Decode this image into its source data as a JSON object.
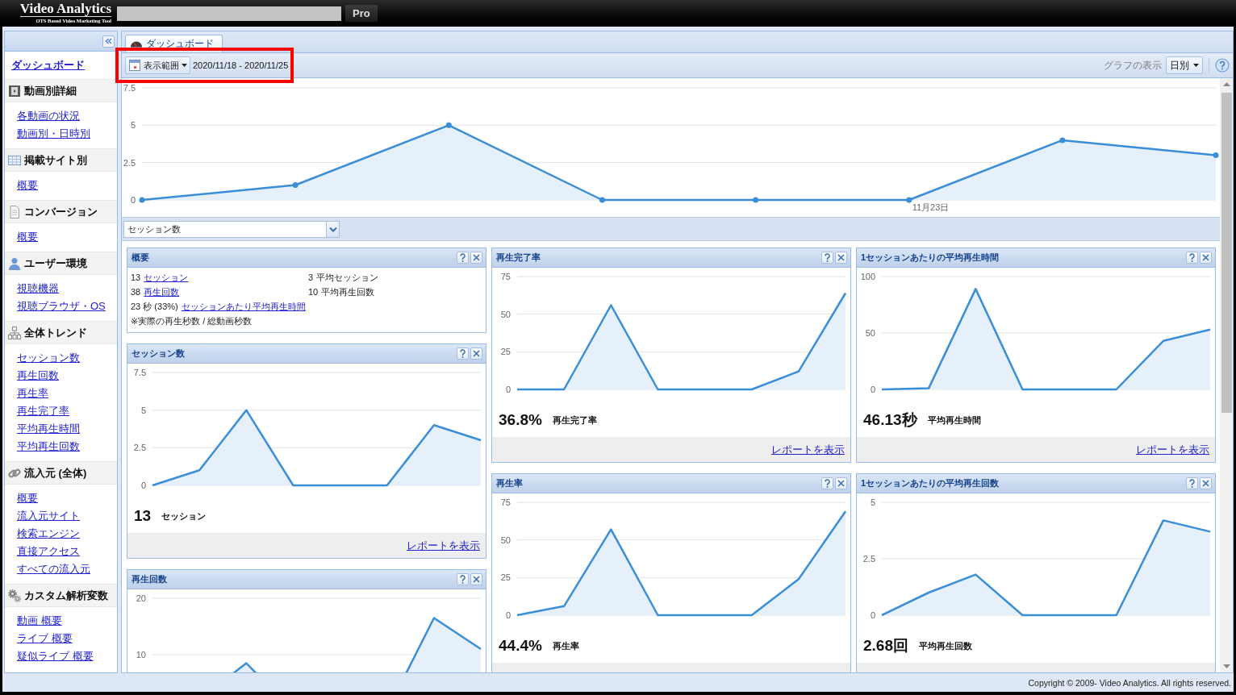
{
  "header": {
    "logo_title": "Video Analytics",
    "logo_tagline": "OTS Based Video Marketing Tool",
    "edition": "Pro"
  },
  "sidebar": {
    "home_link": "ダッシュボード",
    "sections": [
      {
        "title": "動画別詳細",
        "kind": "video",
        "items": [
          "各動画の状況",
          "動画別・日時別"
        ]
      },
      {
        "title": "掲載サイト別",
        "kind": "table",
        "items": [
          "概要"
        ]
      },
      {
        "title": "コンバージョン",
        "kind": "document",
        "items": [
          "概要"
        ]
      },
      {
        "title": "ユーザー環境",
        "kind": "user",
        "items": [
          "視聴機器",
          "視聴ブラウザ・OS"
        ]
      },
      {
        "title": "全体トレンド",
        "kind": "hierarchy",
        "items": [
          "セッション数",
          "再生回数",
          "再生率",
          "再生完了率",
          "平均再生時間",
          "平均再生回数"
        ]
      },
      {
        "title": "流入元 (全体)",
        "kind": "link",
        "items": [
          "概要",
          "流入元サイト",
          "検索エンジン",
          "直接アクセス",
          "すべての流入元"
        ]
      },
      {
        "title": "カスタム解析変数",
        "kind": "gears",
        "items": [
          "動画 概要",
          "ライブ 概要",
          "疑似ライブ 概要"
        ]
      }
    ]
  },
  "tabs": [
    {
      "label": "ダッシュボード",
      "selected": true
    }
  ],
  "toolbar": {
    "range_button": "表示範囲",
    "date_range": "2020/11/18 - 2020/11/25",
    "highlighted": true,
    "graph_label": "グラフの表示",
    "graph_interval": "日別"
  },
  "main_chart": {
    "markers": true,
    "chart_data": {
      "type": "area",
      "categories": [
        null,
        null,
        null,
        null,
        null,
        "11月23日",
        null,
        null
      ],
      "series": [
        {
          "color": "#3a8ed8",
          "values": [
            0,
            1,
            5,
            0,
            0,
            0,
            4,
            3
          ]
        }
      ],
      "ylim": [
        0,
        7.5
      ],
      "yticks": [
        0,
        2.5,
        5,
        7.5
      ]
    }
  },
  "metric_select": {
    "value": "セッション数"
  },
  "columns": [
    {
      "panels": [
        {
          "kind": "summary",
          "title": "概要",
          "rows": [
            {
              "cells": [
                {
                  "value": "13",
                  "label": "セッション",
                  "kind": "link"
                },
                {
                  "value": "3",
                  "label": "平均セッション",
                  "kind": "text"
                }
              ]
            },
            {
              "cells": [
                {
                  "value": "38",
                  "label": "再生回数",
                  "kind": "link"
                },
                {
                  "value": "10",
                  "label": "平均再生回数",
                  "kind": "text"
                }
              ]
            },
            {
              "cells": [
                {
                  "value": "23 秒 (33%)",
                  "label": "セッションあたり平均再生時間",
                  "kind": "link"
                }
              ]
            }
          ],
          "note": "※実際の再生秒数 / 総動画秒数"
        },
        {
          "kind": "metric",
          "title": "セッション数",
          "chart_data": {
            "type": "area",
            "categories": [
              null,
              null,
              null,
              null,
              null,
              null,
              null,
              null
            ],
            "series": [
              {
                "color": "#3a8ed8",
                "values": [
                  0,
                  1,
                  5,
                  0,
                  0,
                  0,
                  4,
                  3
                ]
              }
            ],
            "ylim": [
              0,
              7.5
            ],
            "yticks": [
              0,
              2.5,
              5,
              7.5
            ]
          },
          "value": "13",
          "value_label": "セッション",
          "link": "レポートを表示"
        },
        {
          "kind": "metric",
          "title": "再生回数",
          "chart_data": {
            "type": "area",
            "categories": [
              null,
              null,
              null,
              null,
              null,
              null,
              null,
              null
            ],
            "series": [
              {
                "color": "#3a8ed8",
                "values": [
                  0,
                  2,
                  8.5,
                  0,
                  0,
                  0,
                  16.5,
                  11
                ]
              }
            ],
            "ylim": [
              0,
              20
            ],
            "yticks": [
              10,
              20
            ]
          }
        }
      ]
    },
    {
      "panels": [
        {
          "kind": "metric",
          "title": "再生完了率",
          "chart_data": {
            "type": "area",
            "categories": [
              null,
              null,
              null,
              null,
              null,
              null,
              null,
              null
            ],
            "series": [
              {
                "color": "#3a8ed8",
                "values": [
                  0,
                  0,
                  56,
                  0,
                  0,
                  0,
                  12,
                  64
                ]
              }
            ],
            "ylim": [
              0,
              75
            ],
            "yticks": [
              0,
              25,
              50,
              75
            ]
          },
          "value": "36.8%",
          "value_label": "再生完了率",
          "link": "レポートを表示"
        },
        {
          "kind": "metric",
          "title": "再生率",
          "chart_data": {
            "type": "area",
            "categories": [
              null,
              null,
              null,
              null,
              null,
              null,
              null,
              null
            ],
            "series": [
              {
                "color": "#3a8ed8",
                "values": [
                  0,
                  6,
                  57,
                  0,
                  0,
                  0,
                  24,
                  69
                ]
              }
            ],
            "ylim": [
              0,
              75
            ],
            "yticks": [
              0,
              25,
              50,
              75
            ]
          },
          "value": "44.4%",
          "value_label": "再生率"
        }
      ]
    },
    {
      "panels": [
        {
          "kind": "metric",
          "title": "1セッションあたりの平均再生時間",
          "chart_data": {
            "type": "area",
            "categories": [
              null,
              null,
              null,
              null,
              null,
              null,
              null,
              null
            ],
            "series": [
              {
                "color": "#3a8ed8",
                "values": [
                  0,
                  1,
                  89,
                  0,
                  0,
                  0,
                  43,
                  53
                ]
              }
            ],
            "ylim": [
              0,
              100
            ],
            "yticks": [
              0,
              50,
              100
            ]
          },
          "value": "46.13秒",
          "value_label": "平均再生時間",
          "link": "レポートを表示"
        },
        {
          "kind": "metric",
          "title": "1セッションあたりの平均再生回数",
          "chart_data": {
            "type": "area",
            "categories": [
              null,
              null,
              null,
              null,
              null,
              null,
              null,
              null
            ],
            "series": [
              {
                "color": "#3a8ed8",
                "values": [
                  0,
                  1,
                  1.8,
                  0,
                  0,
                  0,
                  4.2,
                  3.7
                ]
              }
            ],
            "ylim": [
              0,
              5
            ],
            "yticks": [
              0,
              2.5,
              5
            ]
          },
          "value": "2.68回",
          "value_label": "平均再生回数"
        }
      ]
    }
  ],
  "footer": {
    "copyright": "Copyright © 2009- Video Analytics. All rights reserved."
  }
}
